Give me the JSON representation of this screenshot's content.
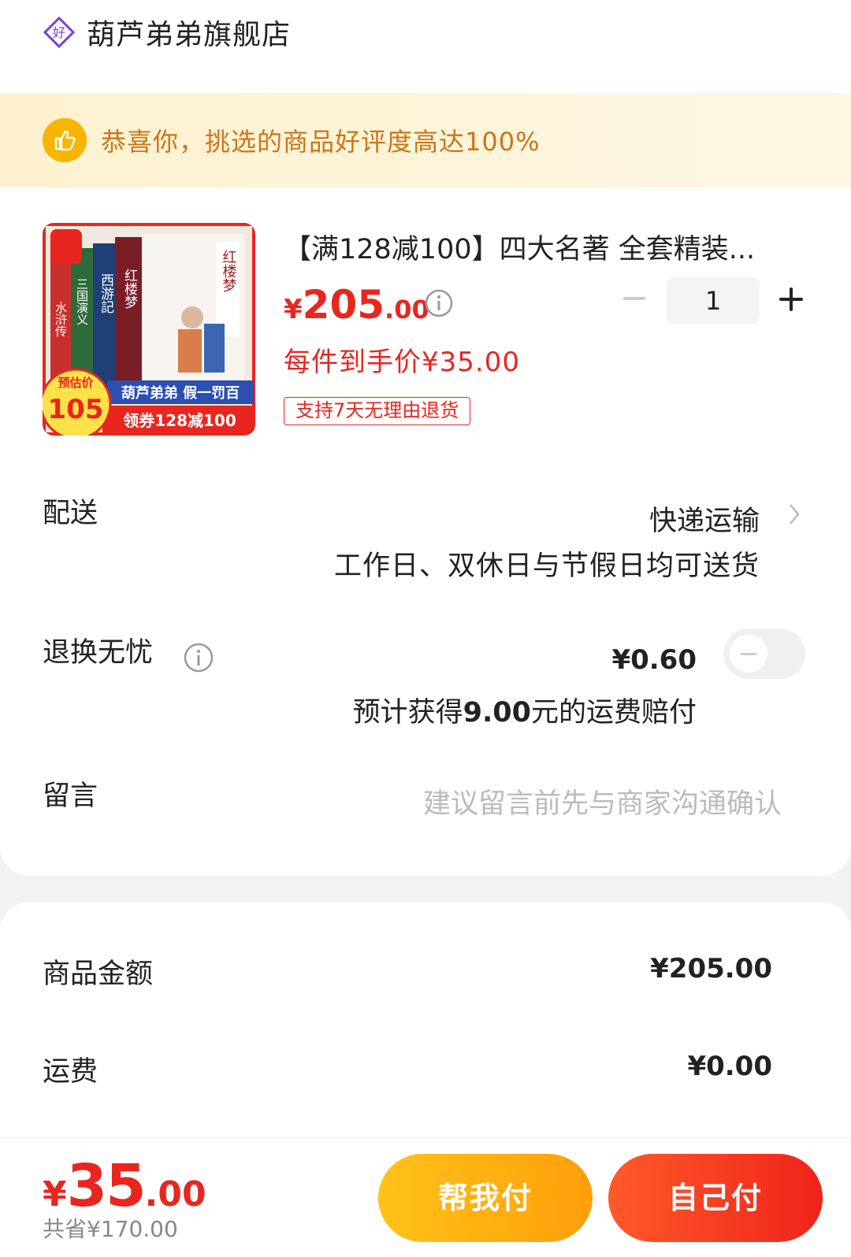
{
  "shop": {
    "name": "葫芦弟弟旗舰店",
    "icon": "good-shop-badge-icon"
  },
  "praise": {
    "text": "恭喜你，挑选的商品好评度高达100%",
    "icon": "thumbs-up-icon"
  },
  "product": {
    "image_texts": [
      "水浒传",
      "三国演义",
      "西游記",
      "红楼梦",
      "红楼梦"
    ],
    "image_badge_label": "预估价",
    "image_badge_value": "105",
    "image_banner_top": "葫芦弟弟 假一罚百",
    "image_banner_bottom": "领券128减100",
    "title": "【满128减100】四大名著 全套精装...",
    "price_symbol": "¥",
    "price_int": "205",
    "price_dec": ".00",
    "unit_price": "每件到手价¥35.00",
    "return_tag": "支持7天无理由退货",
    "quantity": "1"
  },
  "delivery": {
    "label": "配送",
    "method": "快递运输",
    "note": "工作日、双休日与节假日均可送货"
  },
  "worry_free": {
    "label": "退换无忧",
    "price": "¥0.60",
    "note_prefix": "预计获得",
    "note_amount": "9.00",
    "note_suffix": "元的运费赔付",
    "enabled": false
  },
  "message": {
    "label": "留言",
    "placeholder": "建议留言前先与商家沟通确认"
  },
  "summary": {
    "goods_label": "商品金额",
    "goods_value": "¥205.00",
    "shipping_label": "运费",
    "shipping_value": "¥0.00"
  },
  "footer": {
    "total_symbol": "¥",
    "total_int": "35",
    "total_dec": ".00",
    "saved": "共省¥170.00",
    "help_pay": "帮我付",
    "self_pay": "自己付"
  },
  "colors": {
    "accent_red": "#e8261f",
    "orange": "#ffa812",
    "praise_text": "#c9761a"
  }
}
